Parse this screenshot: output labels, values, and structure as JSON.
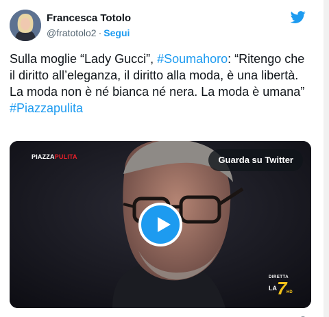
{
  "author": {
    "name": "Francesca Totolo",
    "handle": "@fratotolo2",
    "separator": "·",
    "follow_label": "Segui"
  },
  "tweet": {
    "line1_pre": "Sulla moglie “Lady Gucci”, ",
    "hashtag1": "#Soumahoro",
    "line1_post": ": “Ritengo che il diritto all’eleganza, il diritto alla moda, è una libertà. La moda non è né bianca né nera. La moda è umana”",
    "hashtag2": "#Piazzapulita"
  },
  "media": {
    "show_logo_part1": "PIAZZA",
    "show_logo_part2": "PULITA",
    "watch_label": "Guarda su Twitter",
    "channel_top": "DIRETTA",
    "channel_la": "LA",
    "channel_seven": "7",
    "channel_hd": "HD"
  },
  "colors": {
    "accent": "#1d9bf0",
    "text": "#0f1419",
    "secondary": "#536471"
  },
  "icons": {
    "brand": "twitter-bird-icon",
    "play": "play-icon"
  }
}
